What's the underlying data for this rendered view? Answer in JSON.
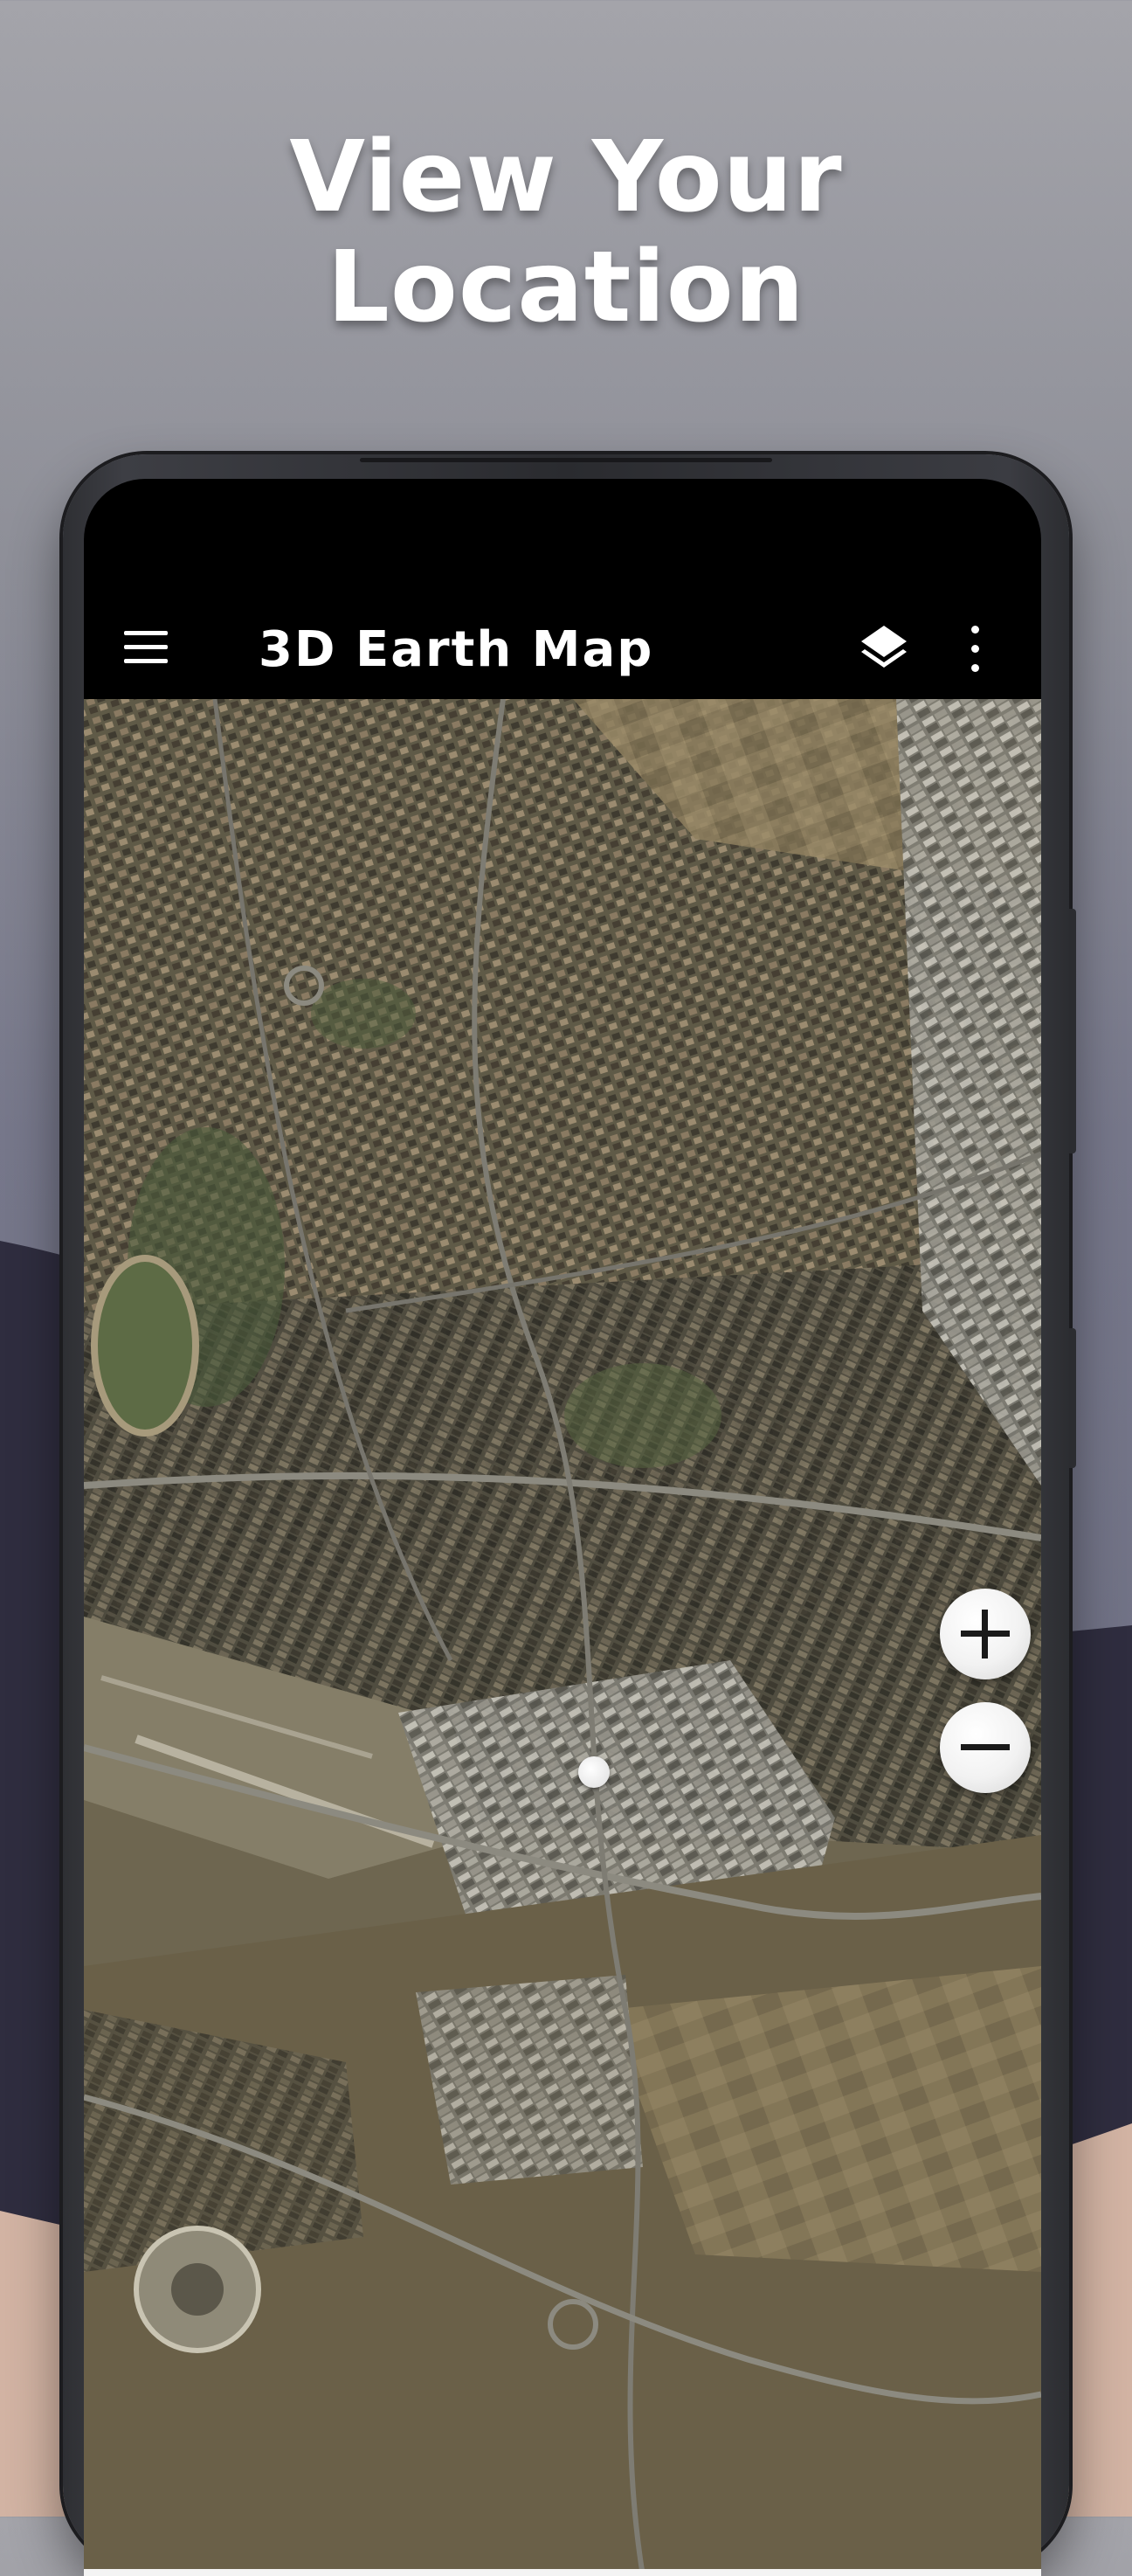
{
  "promo": {
    "headline_line1": "View Your",
    "headline_line2": "Location"
  },
  "app": {
    "title": "3D Earth Map"
  },
  "toolbar": {
    "menu_icon": "hamburger-menu-icon",
    "layers_icon": "layers-icon",
    "more_icon": "more-vert-icon"
  },
  "map": {
    "view": "satellite",
    "zoom_in_icon": "plus-icon",
    "zoom_out_icon": "minus-icon",
    "location_marker": "current-location-dot"
  },
  "colors": {
    "toolbar_bg": "#000000",
    "headline_text": "#ffffff",
    "zoom_button_bg": "#f2f2f2",
    "background_top": "#a4a4aa",
    "background_dark_band": "#2f2d3f",
    "background_pink": "#d7b8a8"
  }
}
